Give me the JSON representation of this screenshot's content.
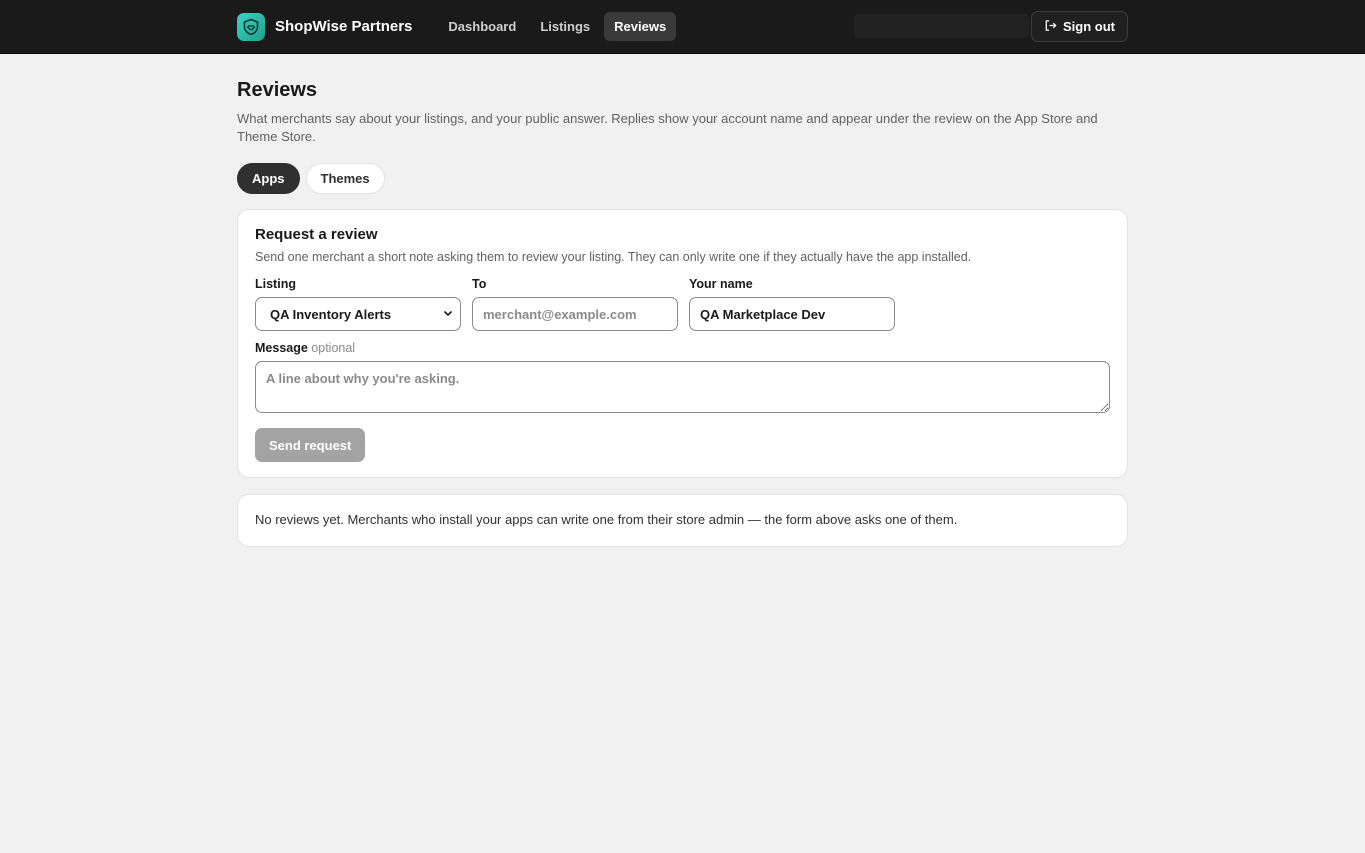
{
  "brand": {
    "name": "ShopWise Partners",
    "logo_icon": "handshake-shield-icon"
  },
  "nav": [
    {
      "label": "Dashboard",
      "active": false
    },
    {
      "label": "Listings",
      "active": false
    },
    {
      "label": "Reviews",
      "active": true
    }
  ],
  "header": {
    "signout_label": "Sign out"
  },
  "page": {
    "title": "Reviews",
    "description": "What merchants say about your listings, and your public answer. Replies show your account name and appear under the review on the App Store and Theme Store."
  },
  "tabs": [
    {
      "label": "Apps",
      "active": true
    },
    {
      "label": "Themes",
      "active": false
    }
  ],
  "request": {
    "title": "Request a review",
    "description": "Send one merchant a short note asking them to review your listing. They can only write one if they actually have the app installed.",
    "listing_label": "Listing",
    "listing_value": "QA Inventory Alerts",
    "to_label": "To",
    "to_placeholder": "merchant@example.com",
    "name_label": "Your name",
    "name_value": "QA Marketplace Dev",
    "message_label": "Message",
    "message_optional": "optional",
    "message_placeholder": "A line about why you're asking.",
    "send_label": "Send request"
  },
  "empty_state": "No reviews yet. Merchants who install your apps can write one from their store admin — the form above asks one of them.",
  "colors": {
    "topbar": "#1a1a1a",
    "accent": "#3ed1c4",
    "disabled_button": "#a3a3a3"
  }
}
